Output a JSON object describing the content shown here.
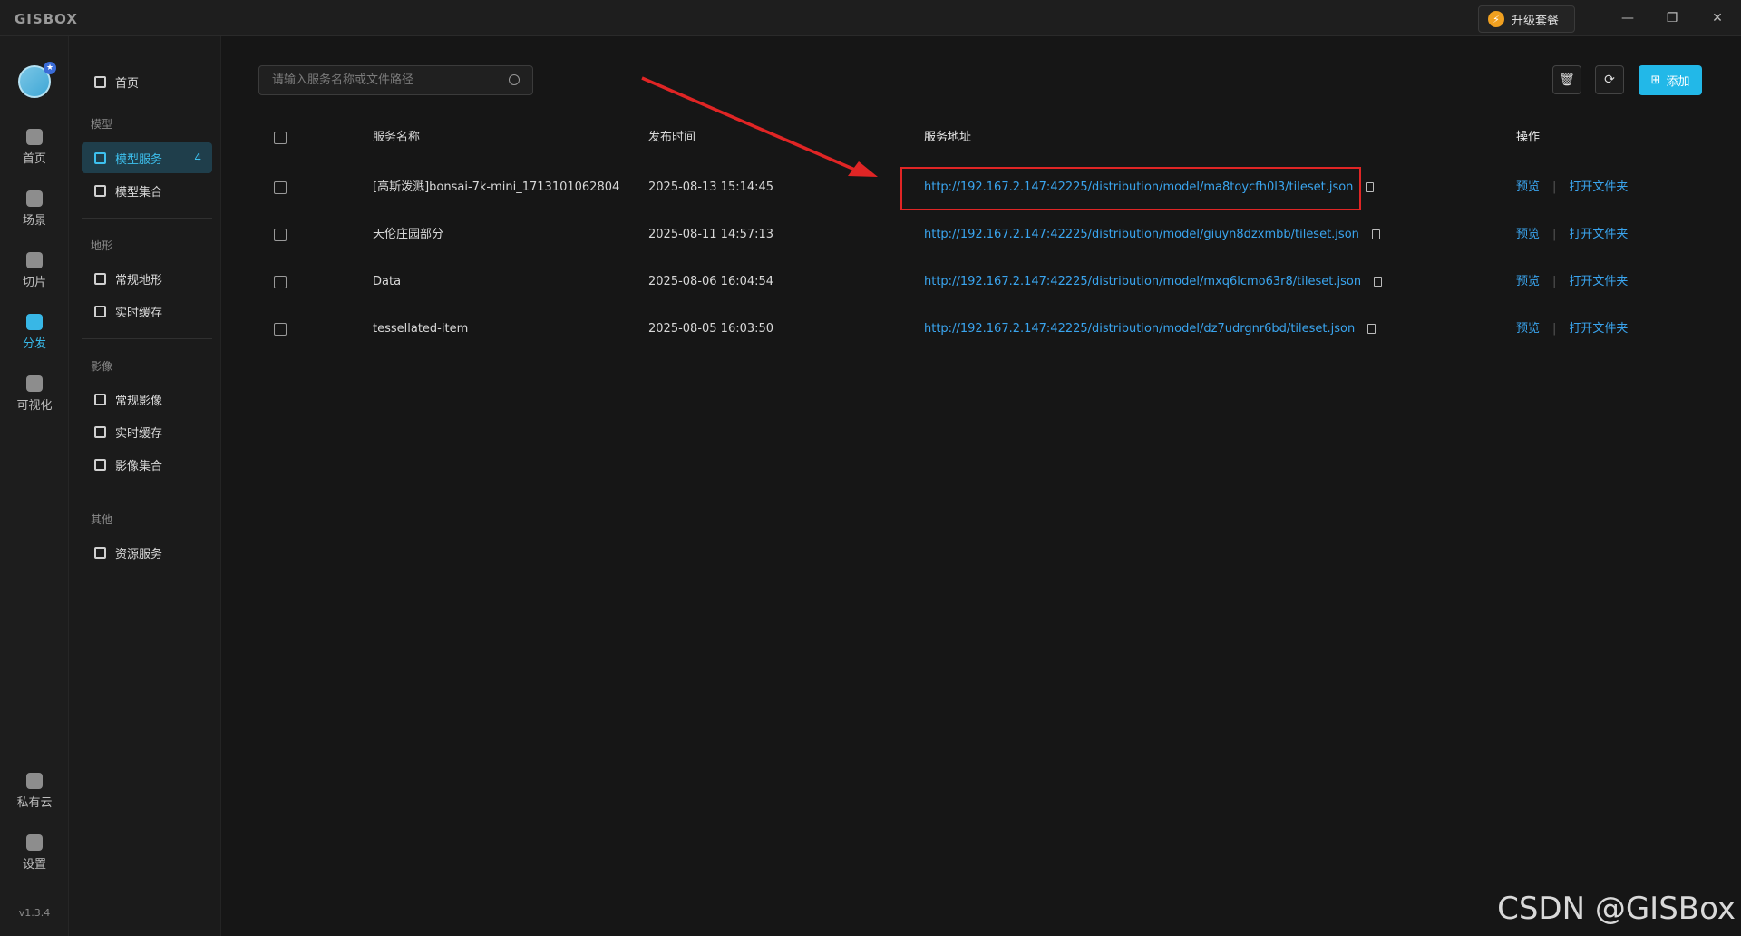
{
  "app": {
    "logo": "GISBOX"
  },
  "titlebar": {
    "upgrade_label": "升级套餐",
    "minimize": "—",
    "restore": "❐",
    "close": "✕"
  },
  "rail": {
    "items": [
      {
        "label": "首页",
        "icon": "home-icon"
      },
      {
        "label": "场景",
        "icon": "cube-icon"
      },
      {
        "label": "切片",
        "icon": "slice-icon"
      },
      {
        "label": "分发",
        "icon": "distribute-icon",
        "active": true
      },
      {
        "label": "可视化",
        "icon": "visual-icon"
      },
      {
        "label": "私有云",
        "icon": "cloud-lock-icon"
      },
      {
        "label": "设置",
        "icon": "settings-icon"
      }
    ],
    "version": "v1.3.4"
  },
  "sidebar": {
    "home": "首页",
    "groups": [
      {
        "title": "模型",
        "items": [
          {
            "label": "模型服务",
            "badge": "4",
            "active": true
          },
          {
            "label": "模型集合"
          }
        ]
      },
      {
        "title": "地形",
        "items": [
          {
            "label": "常规地形"
          },
          {
            "label": "实时缓存"
          }
        ]
      },
      {
        "title": "影像",
        "items": [
          {
            "label": "常规影像"
          },
          {
            "label": "实时缓存"
          },
          {
            "label": "影像集合"
          }
        ]
      },
      {
        "title": "其他",
        "items": [
          {
            "label": "资源服务"
          }
        ]
      }
    ]
  },
  "toolbar": {
    "search_placeholder": "请输入服务名称或文件路径",
    "add_label": "添加",
    "delete_icon": "trash-icon",
    "refresh_icon": "refresh-icon"
  },
  "table": {
    "headers": {
      "name": "服务名称",
      "time": "发布时间",
      "url": "服务地址",
      "ops": "操作"
    },
    "rows": [
      {
        "name": "[高斯泼溅]bonsai-7k-mini_1713101062804",
        "time": "2025-08-13 15:14:45",
        "url": "http://192.167.2.147:42225/distribution/model/ma8toycfh0l3/tileset.json",
        "preview": "预览",
        "open": "打开文件夹"
      },
      {
        "name": "天伦庄园部分",
        "time": "2025-08-11 14:57:13",
        "url": "http://192.167.2.147:42225/distribution/model/giuyn8dzxmbb/tileset.json",
        "preview": "预览",
        "open": "打开文件夹"
      },
      {
        "name": "Data",
        "time": "2025-08-06 16:04:54",
        "url": "http://192.167.2.147:42225/distribution/model/mxq6lcmo63r8/tileset.json",
        "preview": "预览",
        "open": "打开文件夹"
      },
      {
        "name": "tessellated-item",
        "time": "2025-08-05 16:03:50",
        "url": "http://192.167.2.147:42225/distribution/model/dz7udrgnr6bd/tileset.json",
        "preview": "预览",
        "open": "打开文件夹"
      }
    ]
  },
  "annotation": {
    "arrow_color": "#e02525",
    "box_color": "#e02525"
  },
  "watermark": "CSDN @GISBox"
}
